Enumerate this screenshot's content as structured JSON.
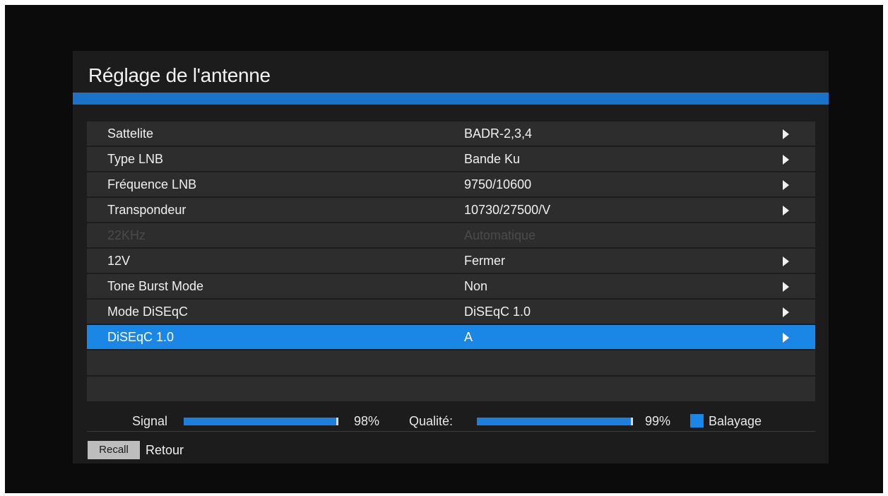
{
  "title": "Réglage de l'antenne",
  "rows": [
    {
      "label": "Sattelite",
      "value": "BADR-2,3,4"
    },
    {
      "label": "Type LNB",
      "value": "Bande Ku"
    },
    {
      "label": "Fréquence LNB",
      "value": "9750/10600"
    },
    {
      "label": "Transpondeur",
      "value": "10730/27500/V"
    },
    {
      "label": "22KHz",
      "value": "Automatique",
      "disabled": true
    },
    {
      "label": "12V",
      "value": "Fermer"
    },
    {
      "label": "Tone Burst Mode",
      "value": "Non"
    },
    {
      "label": "Mode DiSEqC",
      "value": "DiSEqC 1.0"
    },
    {
      "label": "DiSEqC 1.0",
      "value": "A",
      "selected": true
    }
  ],
  "status": {
    "signal_label": "Signal",
    "signal_value": "98%",
    "signal_level": 0.98,
    "quality_label": "Qualité:",
    "quality_value": "99%",
    "quality_level": 0.99,
    "scan_label": "Balayage"
  },
  "help": {
    "key": "Recall",
    "label": "Retour"
  },
  "colors": {
    "accent": "#1a86e6",
    "background": "#1c1c1c",
    "row": "#2d2d2d"
  }
}
